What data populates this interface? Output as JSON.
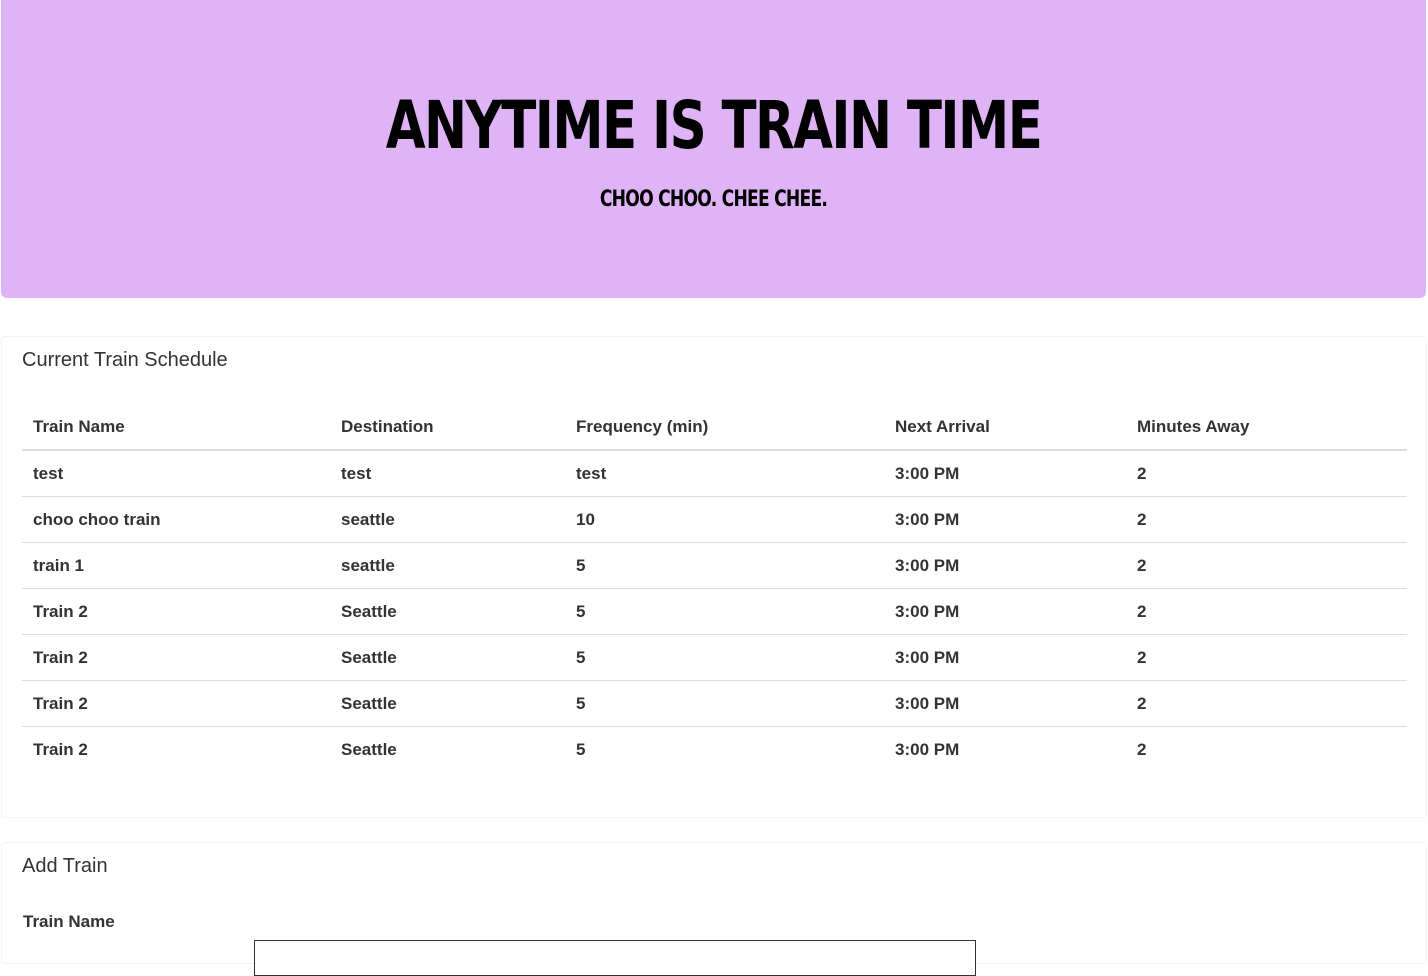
{
  "header": {
    "title": "ANYTIME IS TRAIN TIME",
    "subtitle": "CHOO CHOO. CHEE CHEE.",
    "background_color": "#dfb4f6"
  },
  "schedule": {
    "title": "Current Train Schedule",
    "columns": [
      "Train Name",
      "Destination",
      "Frequency (min)",
      "Next Arrival",
      "Minutes Away"
    ],
    "rows": [
      [
        "test",
        "test",
        "test",
        "3:00 PM",
        "2"
      ],
      [
        "choo choo train",
        "seattle",
        "10",
        "3:00 PM",
        "2"
      ],
      [
        "train 1",
        "seattle",
        "5",
        "3:00 PM",
        "2"
      ],
      [
        "Train 2",
        "Seattle",
        "5",
        "3:00 PM",
        "2"
      ],
      [
        "Train 2",
        "Seattle",
        "5",
        "3:00 PM",
        "2"
      ],
      [
        "Train 2",
        "Seattle",
        "5",
        "3:00 PM",
        "2"
      ],
      [
        "Train 2",
        "Seattle",
        "5",
        "3:00 PM",
        "2"
      ]
    ]
  },
  "add_train": {
    "title": "Add Train",
    "train_name_label": "Train Name"
  }
}
